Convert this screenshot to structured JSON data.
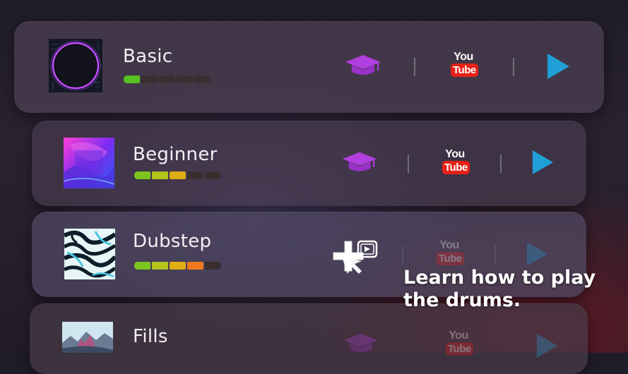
{
  "lessons": [
    {
      "title": "Basic",
      "difficulty_level": 1,
      "difficulty_max": 5,
      "segment_colors": [
        "#59c022",
        "#3a2e30",
        "#3a2e30",
        "#3a2e30",
        "#3a2e30"
      ],
      "youtube_you": "You",
      "youtube_tube": "Tube",
      "icons": [
        "graduation-cap-icon",
        "youtube-icon",
        "play-icon"
      ]
    },
    {
      "title": "Beginner",
      "difficulty_level": 3,
      "difficulty_max": 5,
      "segment_colors": [
        "#7cc51e",
        "#b4c41a",
        "#e0ad13",
        "#3a2e30",
        "#3a2e30"
      ],
      "youtube_you": "You",
      "youtube_tube": "Tube",
      "icons": [
        "graduation-cap-icon",
        "youtube-icon",
        "play-icon"
      ]
    },
    {
      "title": "Dubstep",
      "difficulty_level": 4,
      "difficulty_max": 5,
      "segment_colors": [
        "#7cc51e",
        "#b4c41a",
        "#e0ad13",
        "#ee7a1c",
        "#3a2e30"
      ],
      "youtube_you": "You",
      "youtube_tube": "Tube",
      "icons": [
        "graduation-cap-icon",
        "youtube-icon",
        "play-icon"
      ]
    },
    {
      "title": "Fills",
      "youtube_you": "You",
      "youtube_tube": "Tube",
      "icons": [
        "graduation-cap-icon",
        "youtube-icon",
        "play-icon"
      ]
    }
  ],
  "tutorial": {
    "line1": "Learn how to play",
    "line2": "the drums."
  },
  "colors": {
    "lesson_icon": "#b23fe0",
    "play_icon": "#1f9fd6",
    "youtube_red": "#e62117"
  }
}
